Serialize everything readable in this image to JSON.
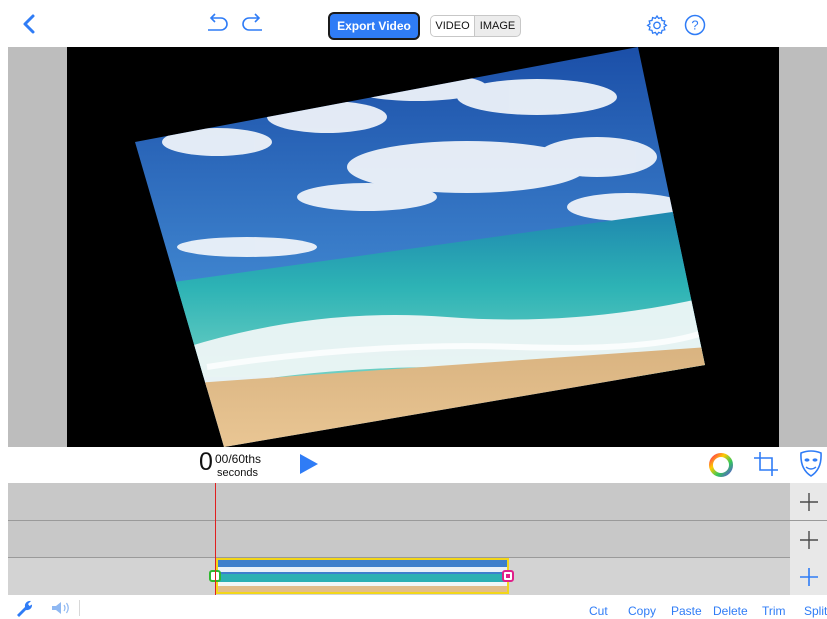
{
  "toolbar": {
    "export_label": "Export Video",
    "mode_video": "VIDEO",
    "mode_image": "IMAGE",
    "icons": [
      "back-icon",
      "undo-icon",
      "redo-icon",
      "settings-gear-icon",
      "help-icon"
    ]
  },
  "preview": {
    "image": "beach-photo"
  },
  "playback": {
    "time_whole": "0",
    "time_fraction": "00/60ths",
    "time_unit": "seconds"
  },
  "tools": {
    "icons": [
      "color-wheel-icon",
      "crop-icon",
      "mask-icon"
    ]
  },
  "timeline": {
    "tracks": 3,
    "add_icon": "plus-icon"
  },
  "bottom_toolbar": {
    "cut": "Cut",
    "copy": "Copy",
    "paste": "Paste",
    "delete": "Delete",
    "trim": "Trim",
    "split": "Split"
  },
  "colors": {
    "accent": "#2f7cf6",
    "playhead": "#e02020",
    "clip_border": "#f2d61a",
    "handle_start": "#2fb82f",
    "handle_end": "#e0208a"
  }
}
